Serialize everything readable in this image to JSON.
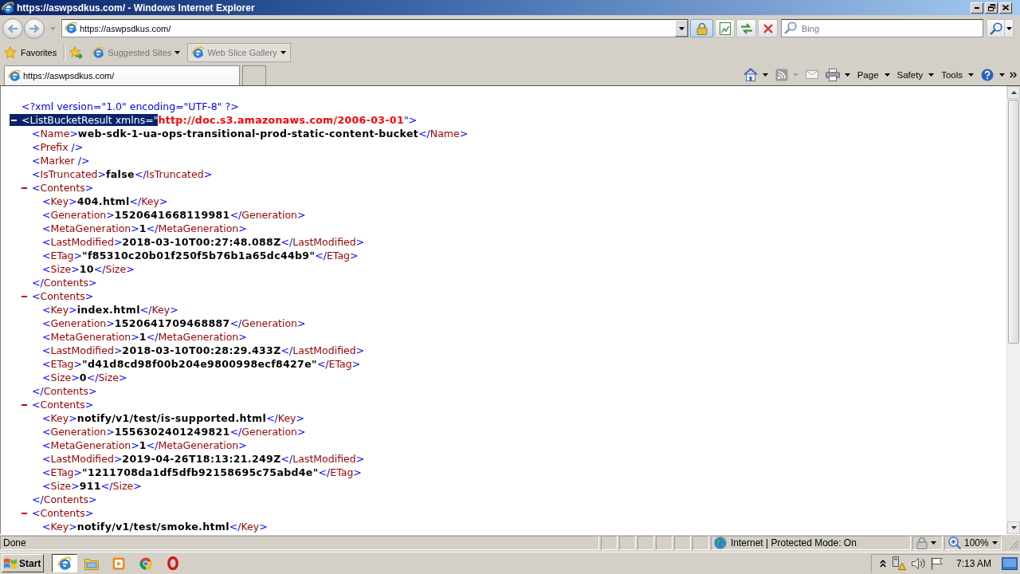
{
  "window": {
    "title": "https://aswpsdkus.com/ - Windows Internet Explorer"
  },
  "address_bar": {
    "url": "https://aswpsdkus.com/"
  },
  "search": {
    "placeholder": "Bing"
  },
  "favorites_bar": {
    "label": "Favorites",
    "items": [
      {
        "label": "Suggested Sites",
        "hovered": false
      },
      {
        "label": "Web Slice Gallery",
        "hovered": true
      }
    ]
  },
  "tabs": [
    {
      "label": "https://aswpsdkus.com/",
      "selected": true
    }
  ],
  "command_bar": [
    {
      "kind": "home"
    },
    {
      "kind": "feeds"
    },
    {
      "kind": "mail"
    },
    {
      "kind": "print"
    },
    {
      "kind": "menu",
      "label": "Page"
    },
    {
      "kind": "menu",
      "label": "Safety"
    },
    {
      "kind": "menu",
      "label": "Tools"
    },
    {
      "kind": "help"
    }
  ],
  "document": {
    "declaration": "<?xml version=\"1.0\" encoding=\"UTF-8\" ?>",
    "root": {
      "kind": "container",
      "open": "<ListBucketResult xmlns=\"",
      "attribute_value": "http://doc.s3.amazonaws.com/2006-03-01",
      "open_end": "\">",
      "expanded": true,
      "highlighted": true,
      "children": [
        {
          "kind": "leaf",
          "open": "<Name>",
          "value": "web-sdk-1-ua-ops-transitional-prod-static-content-bucket",
          "close": "</Name>"
        },
        {
          "kind": "empty",
          "tag": "<Prefix />"
        },
        {
          "kind": "empty",
          "tag": "<Marker />"
        },
        {
          "kind": "leaf",
          "open": "<IsTruncated>",
          "value": "false",
          "close": "</IsTruncated>"
        },
        {
          "kind": "container",
          "open": "<Contents>",
          "close": "</Contents>",
          "expanded": true,
          "highlighted": false,
          "children": [
            {
              "kind": "leaf",
              "open": "<Key>",
              "value": "404.html",
              "close": "</Key>"
            },
            {
              "kind": "leaf",
              "open": "<Generation>",
              "value": "1520641668119981",
              "close": "</Generation>"
            },
            {
              "kind": "leaf",
              "open": "<MetaGeneration>",
              "value": "1",
              "close": "</MetaGeneration>"
            },
            {
              "kind": "leaf",
              "open": "<LastModified>",
              "value": "2018-03-10T00:27:48.088Z",
              "close": "</LastModified>"
            },
            {
              "kind": "leaf",
              "open": "<ETag>",
              "value": "\"f85310c20b01f250f5b76b1a65dc44b9\"",
              "close": "</ETag>"
            },
            {
              "kind": "leaf",
              "open": "<Size>",
              "value": "10",
              "close": "</Size>"
            }
          ]
        },
        {
          "kind": "container",
          "open": "<Contents>",
          "close": "</Contents>",
          "expanded": true,
          "highlighted": false,
          "children": [
            {
              "kind": "leaf",
              "open": "<Key>",
              "value": "index.html",
              "close": "</Key>"
            },
            {
              "kind": "leaf",
              "open": "<Generation>",
              "value": "1520641709468887",
              "close": "</Generation>"
            },
            {
              "kind": "leaf",
              "open": "<MetaGeneration>",
              "value": "1",
              "close": "</MetaGeneration>"
            },
            {
              "kind": "leaf",
              "open": "<LastModified>",
              "value": "2018-03-10T00:28:29.433Z",
              "close": "</LastModified>"
            },
            {
              "kind": "leaf",
              "open": "<ETag>",
              "value": "\"d41d8cd98f00b204e9800998ecf8427e\"",
              "close": "</ETag>"
            },
            {
              "kind": "leaf",
              "open": "<Size>",
              "value": "0",
              "close": "</Size>"
            }
          ]
        },
        {
          "kind": "container",
          "open": "<Contents>",
          "close": "</Contents>",
          "expanded": true,
          "highlighted": false,
          "children": [
            {
              "kind": "leaf",
              "open": "<Key>",
              "value": "notify/v1/test/is-supported.html",
              "close": "</Key>"
            },
            {
              "kind": "leaf",
              "open": "<Generation>",
              "value": "1556302401249821",
              "close": "</Generation>"
            },
            {
              "kind": "leaf",
              "open": "<MetaGeneration>",
              "value": "1",
              "close": "</MetaGeneration>"
            },
            {
              "kind": "leaf",
              "open": "<LastModified>",
              "value": "2019-04-26T18:13:21.249Z",
              "close": "</LastModified>"
            },
            {
              "kind": "leaf",
              "open": "<ETag>",
              "value": "\"1211708da1df5dfb92158695c75abd4e\"",
              "close": "</ETag>"
            },
            {
              "kind": "leaf",
              "open": "<Size>",
              "value": "911",
              "close": "</Size>"
            }
          ]
        },
        {
          "kind": "container",
          "open": "<Contents>",
          "expanded": true,
          "highlighted": false,
          "children": [
            {
              "kind": "leaf",
              "open": "<Key>",
              "value": "notify/v1/test/smoke.html",
              "close": "</Key>"
            }
          ]
        }
      ]
    }
  },
  "status_bar": {
    "text": "Done",
    "zone": "Internet | Protected Mode: On",
    "zoom": "100%"
  },
  "taskbar": {
    "start": "Start",
    "apps": [
      {
        "kind": "browser",
        "selected": true
      },
      {
        "kind": "folder",
        "selected": false
      },
      {
        "kind": "media",
        "selected": false
      },
      {
        "kind": "chrome",
        "selected": false
      },
      {
        "kind": "opera",
        "selected": false
      }
    ],
    "clock": "7:13 AM"
  }
}
